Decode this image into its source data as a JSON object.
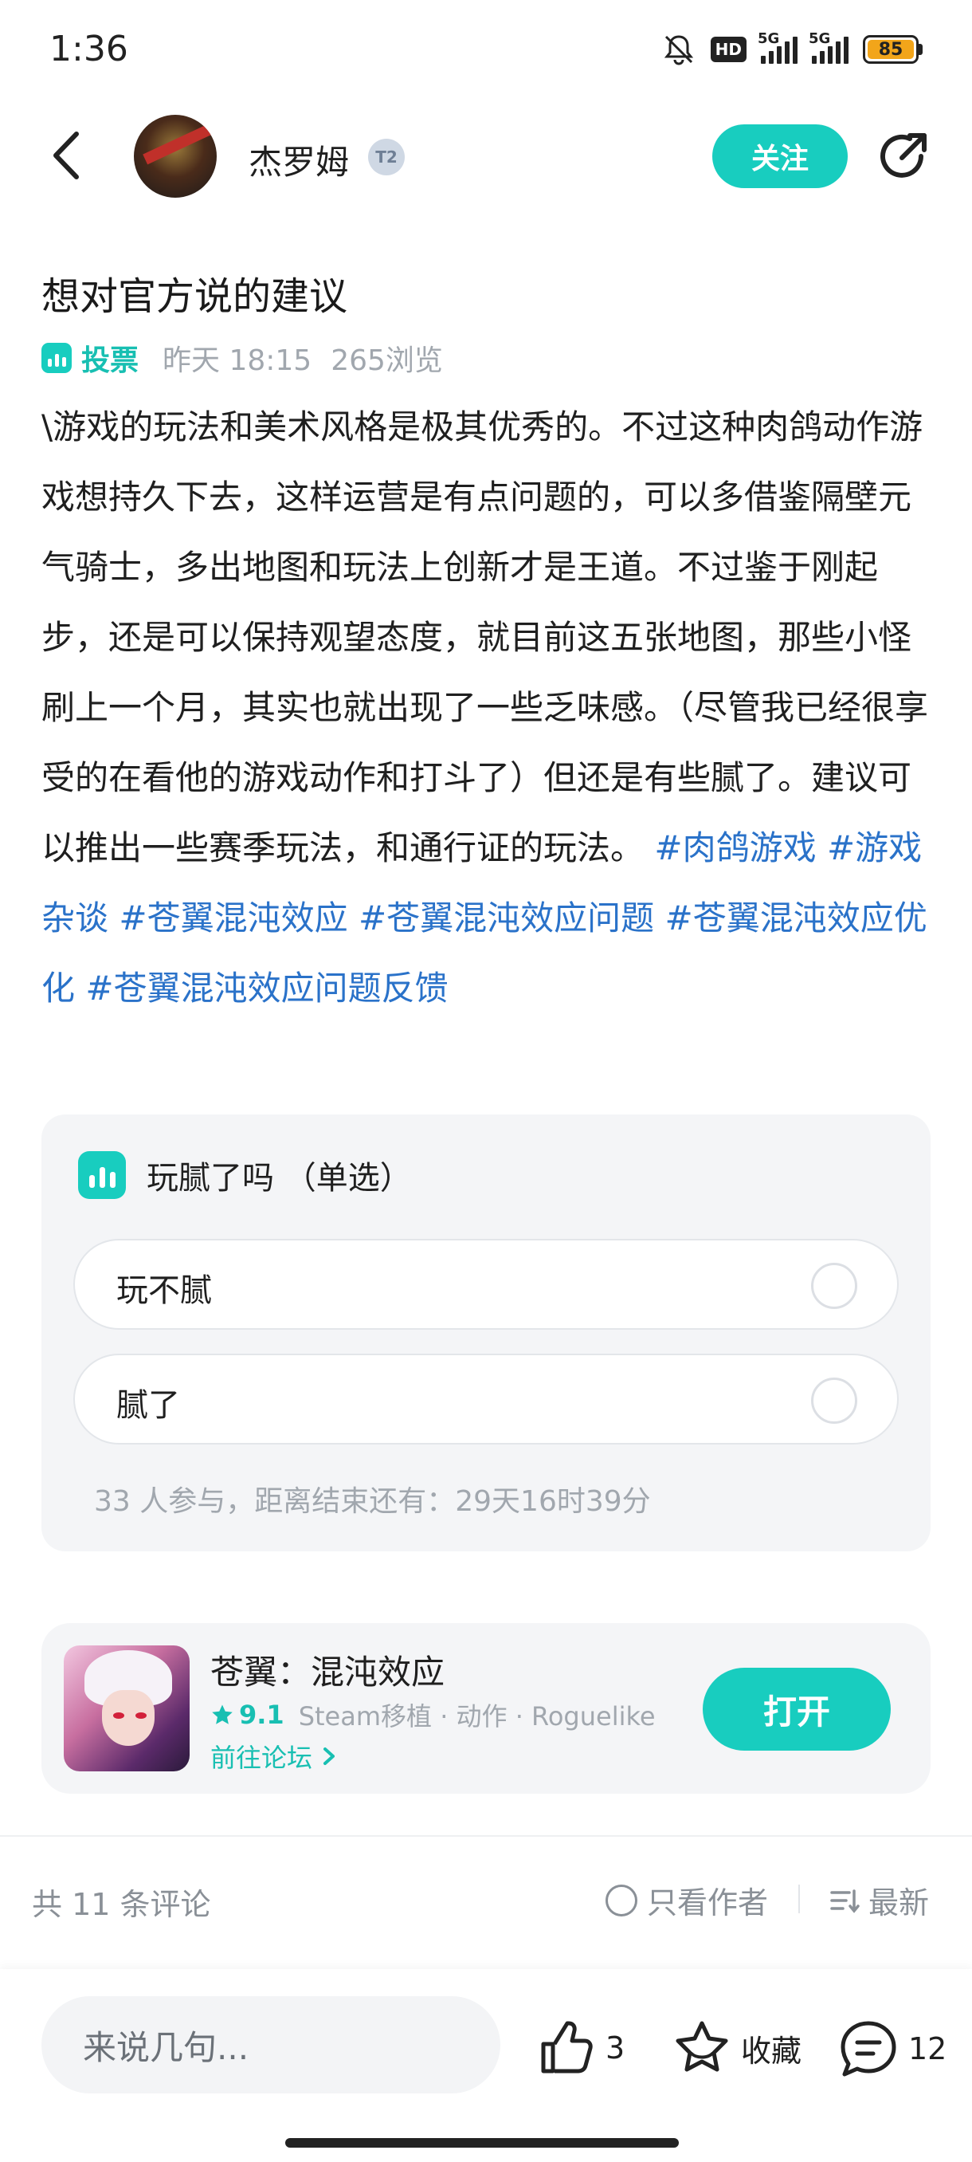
{
  "status_bar": {
    "time": "1:36",
    "hd_label": "HD",
    "network_label_1": "5G",
    "network_label_2": "5G",
    "battery_level": "85",
    "icons": [
      "mute-bell-icon",
      "hd-voice-icon",
      "signal-icon",
      "signal-icon",
      "battery-icon"
    ]
  },
  "header": {
    "author_name": "杰罗姆",
    "level_badge": "T2",
    "follow_label": "关注",
    "icons": [
      "back-icon",
      "share-icon"
    ]
  },
  "post": {
    "title": "想对官方说的建议",
    "vote_tag": "投票",
    "time": "昨天 18:15",
    "views": "265浏览",
    "body": "\\游戏的玩法和美术风格是极其优秀的。不过这种肉鸽动作游戏想持久下去，这样运营是有点问题的，可以多借鉴隔壁元气骑士，多出地图和玩法上创新才是王道。不过鉴于刚起步，还是可以保持观望态度，就目前这五张地图，那些小怪刷上一个月，其实也就出现了一些乏味感。（尽管我已经很享受的在看他的游戏动作和打斗了）但还是有些腻了。建议可以推出一些赛季玩法，和通行证的玩法。",
    "hashtags": [
      "#肉鸽游戏",
      "#游戏杂谈",
      "#苍翼混沌效应",
      "#苍翼混沌效应问题",
      "#苍翼混沌效应优化",
      "#苍翼混沌效应问题反馈"
    ]
  },
  "poll": {
    "title": "玩腻了吗 （单选）",
    "options": [
      {
        "label": "玩不腻"
      },
      {
        "label": "腻了"
      }
    ],
    "footer": "33 人参与，距离结束还有：29天16时39分"
  },
  "game": {
    "name": "苍翼：混沌效应",
    "rating": "9.1",
    "tags": "Steam移植 · 动作 · Roguelike",
    "forum_link": "前往论坛",
    "open_label": "打开"
  },
  "comments": {
    "count_label": "共 11 条评论",
    "author_only_label": "只看作者",
    "sort_label": "最新"
  },
  "bottom_bar": {
    "input_placeholder": "来说几句...",
    "like_count": "3",
    "favorite_label": "收藏",
    "comment_count": "12"
  },
  "colors": {
    "accent": "#18cdbf",
    "hashtag": "#2a72c9",
    "muted_text": "#a1a7ae",
    "card_bg": "#f4f5f7"
  }
}
